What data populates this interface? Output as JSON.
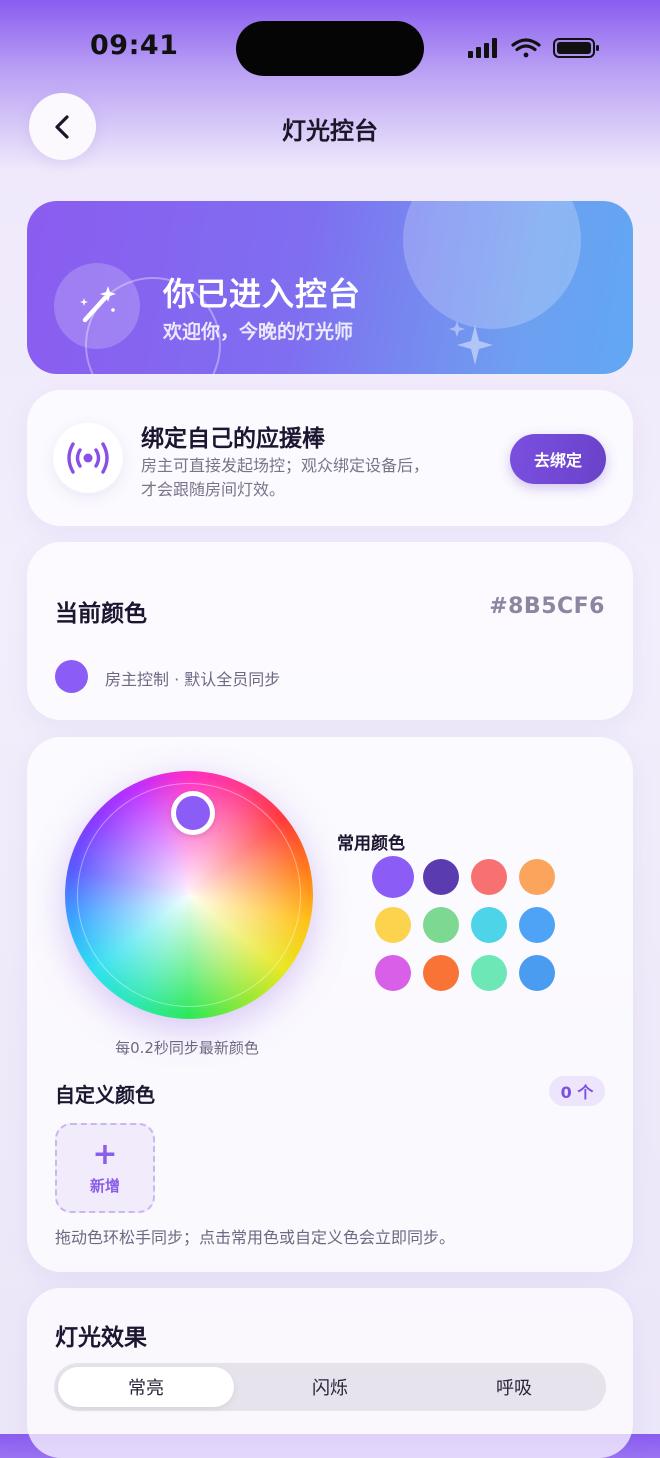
{
  "status_bar": {
    "time": "09:41"
  },
  "nav": {
    "title": "灯光控台",
    "back_icon": "chevron-left-icon"
  },
  "banner": {
    "title": "你已进入控台",
    "subtitle": "欢迎你，今晚的灯光师",
    "icon": "magic-wand-icon"
  },
  "bind": {
    "icon": "broadcast-icon",
    "title": "绑定自己的应援棒",
    "desc_line1": "房主可直接发起场控；观众绑定设备后，",
    "desc_line2": "才会跟随房间灯效。",
    "button": "去绑定"
  },
  "current_color": {
    "label": "当前颜色",
    "hex": "#8B5CF6",
    "note": "房主控制 · 默认全员同步",
    "swatch_color": "#8B5CF6"
  },
  "picker": {
    "wheel_hint": "每0.2秒同步最新颜色",
    "common_label": "常用颜色",
    "common_colors": [
      "#8B5CF6",
      "#5B3BB0",
      "#F87171",
      "#FBA55C",
      "#FCD34D",
      "#7DD891",
      "#4DD4E8",
      "#4FA3F7",
      "#D85FE8",
      "#F97336",
      "#6EE7B7",
      "#4A9CF0"
    ],
    "selected_index": 0,
    "custom_label": "自定义颜色",
    "custom_count": "0 个",
    "add_label": "新增",
    "footer": "拖动色环松手同步；点击常用色或自定义色会立即同步。"
  },
  "effects": {
    "label": "灯光效果",
    "options": [
      "常亮",
      "闪烁",
      "呼吸"
    ],
    "active_index": 0
  }
}
